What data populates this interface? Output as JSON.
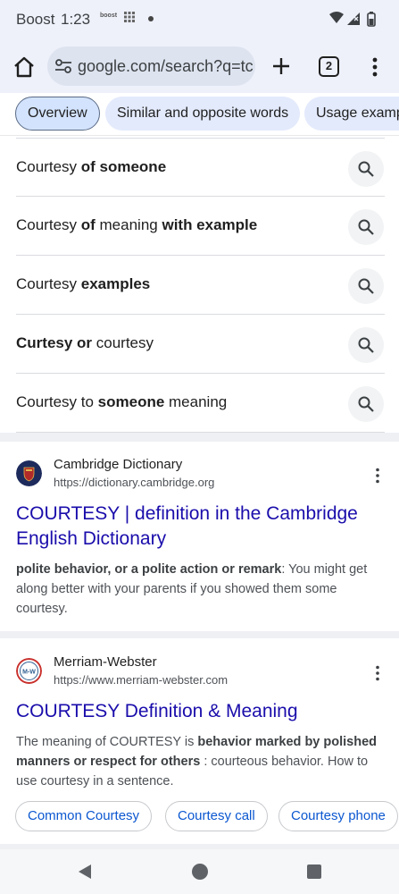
{
  "status_bar": {
    "carrier": "Boost",
    "time": "1:23",
    "small_logo": "boost"
  },
  "browser": {
    "url": "google.com/search?q=tc",
    "tab_count": "2"
  },
  "chips": [
    {
      "label": "Overview",
      "active": true
    },
    {
      "label": "Similar and opposite words",
      "active": false
    },
    {
      "label": "Usage examp",
      "active": false
    }
  ],
  "related_searches": [
    {
      "parts": [
        {
          "t": "Courtesy ",
          "b": false
        },
        {
          "t": "of someone",
          "b": true
        }
      ]
    },
    {
      "parts": [
        {
          "t": "Courtesy ",
          "b": false
        },
        {
          "t": "of",
          "b": true
        },
        {
          "t": " meaning ",
          "b": false
        },
        {
          "t": "with example",
          "b": true
        }
      ]
    },
    {
      "parts": [
        {
          "t": "Courtesy ",
          "b": false
        },
        {
          "t": "examples",
          "b": true
        }
      ]
    },
    {
      "parts": [
        {
          "t": "Curtesy or",
          "b": true
        },
        {
          "t": " courtesy",
          "b": false
        }
      ]
    },
    {
      "parts": [
        {
          "t": "Courtesy to ",
          "b": false
        },
        {
          "t": "someone",
          "b": true
        },
        {
          "t": " meaning",
          "b": false
        }
      ]
    }
  ],
  "results": [
    {
      "site_name": "Cambridge Dictionary",
      "site_url": "https://dictionary.cambridge.org",
      "title": "COURTESY | definition in the Cambridge English Dictionary",
      "snippet_parts": [
        {
          "t": "polite behavior, or a polite action or remark",
          "b": true
        },
        {
          "t": ": You might get along better with your parents if you showed them some courtesy.",
          "b": false
        }
      ],
      "favicon_label": "Cambridge"
    },
    {
      "site_name": "Merriam-Webster",
      "site_url": "https://www.merriam-webster.com",
      "title": "COURTESY Definition & Meaning",
      "snippet_parts": [
        {
          "t": "The meaning of COURTESY is ",
          "b": false
        },
        {
          "t": "behavior marked by polished manners or respect for others",
          "b": true
        },
        {
          "t": " : courteous behavior. How to use courtesy in a sentence.",
          "b": false
        }
      ],
      "favicon_label": "M-W",
      "pills": [
        "Common Courtesy",
        "Courtesy call",
        "Courtesy phone"
      ]
    }
  ],
  "colors": {
    "link": "#1a0dab",
    "pill_text": "#0b57d0",
    "chip_bg": "#e3eafc",
    "toolbar_bg": "#eef1fa"
  },
  "icons": {
    "home": "home-icon",
    "tune": "tune-icon",
    "plus": "new-tab-icon",
    "menu": "more-vert-icon",
    "search": "search-icon",
    "back": "back-triangle-icon",
    "home_nav": "home-circle-icon",
    "recents": "recents-square-icon"
  }
}
